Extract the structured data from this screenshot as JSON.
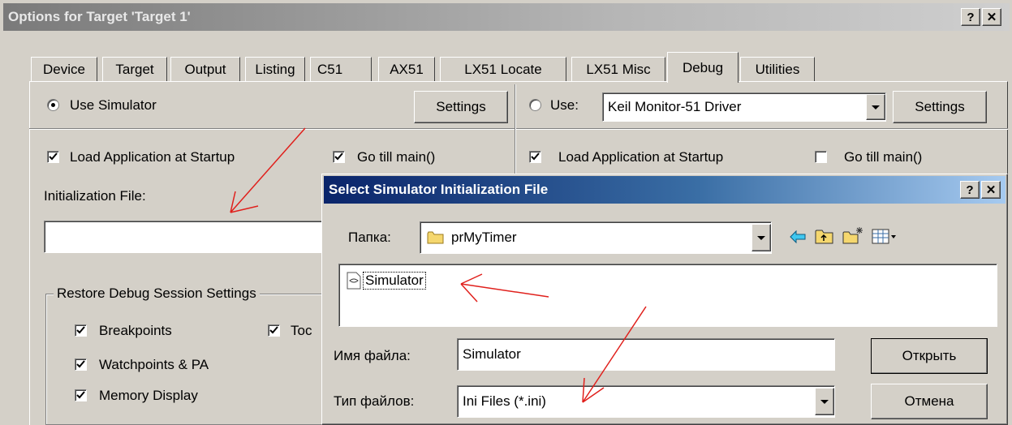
{
  "main_dialog": {
    "title": "Options for Target 'Target 1'",
    "help_btn": "?",
    "close_btn": "✕",
    "tabs": [
      "Device",
      "Target",
      "Output",
      "Listing",
      "C51",
      "AX51",
      "LX51 Locate",
      "LX51 Misc",
      "Debug",
      "Utilities"
    ],
    "selected_tab": "Debug",
    "left": {
      "use_simulator": "Use Simulator",
      "settings": "Settings",
      "load_app": "Load Application at Startup",
      "go_main": "Go  till main()",
      "init_file_label": "Initialization File:",
      "init_file_value": "",
      "restore_group": "Restore Debug Session Settings",
      "breakpoints": "Breakpoints",
      "toolbox": "Toc",
      "watchpoints": "Watchpoints & PA",
      "memory_display": "Memory Display"
    },
    "right": {
      "use": "Use:",
      "driver": "Keil Monitor-51 Driver",
      "settings": "Settings",
      "load_app": "Load Application at Startup",
      "go_main": "Go  till main()"
    }
  },
  "file_dialog": {
    "title": "Select Simulator Initialization File",
    "help_btn": "?",
    "close_btn": "✕",
    "folder_label": "Папка:",
    "folder_value": "prMyTimer",
    "file_item": "Simulator",
    "filename_label": "Имя файла:",
    "filename_value": "Simulator",
    "filetype_label": "Тип файлов:",
    "filetype_value": "Ini Files (*.ini)",
    "open_btn": "Открыть",
    "cancel_btn": "Отмена"
  },
  "colors": {
    "face": "#d4d0c8",
    "active_title": "#0a246a",
    "inactive_title": "#808080",
    "annotation_red": "#e0201c"
  }
}
